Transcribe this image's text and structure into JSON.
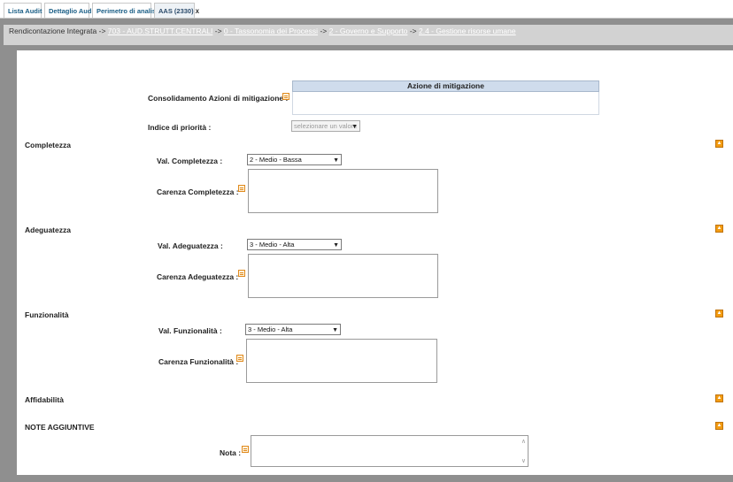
{
  "tabs": [
    {
      "label": "Lista Audit"
    },
    {
      "label": "Dettaglio Audit"
    },
    {
      "label": "Perimetro di analisi"
    },
    {
      "label": "AAS (2330)",
      "close": "x"
    }
  ],
  "breadcrumb": {
    "root": "Rendicontazione Integrata",
    "sep": "->",
    "items": [
      "703 - AUD.STRUTT.CENTRALI",
      "0 - Tassonomia dei Processi",
      "2 - Governo e Supporto",
      "2.4 - Gestione risorse umane"
    ]
  },
  "mitigation": {
    "label": "Consolidamento Azioni di mitigazione :",
    "table_header": "Azione di mitigazione"
  },
  "priority": {
    "label": "Indice di priorità :",
    "value": "selezionare un valore"
  },
  "sections": {
    "completezza": {
      "title": "Completezza",
      "val_label": "Val. Completezza :",
      "val_value": "2 - Medio - Bassa",
      "carenza_label": "Carenza Completezza :"
    },
    "adeguatezza": {
      "title": "Adeguatezza",
      "val_label": "Val. Adeguatezza :",
      "val_value": "3 - Medio - Alta",
      "carenza_label": "Carenza Adeguatezza :"
    },
    "funzionalita": {
      "title": "Funzionalità",
      "val_label": "Val. Funzionalità :",
      "val_value": "3 - Medio - Alta",
      "carenza_label": "Carenza Funzionalità :"
    },
    "affidabilita": {
      "title": "Affidabilità"
    },
    "note": {
      "title": "NOTE AGGIUNTIVE",
      "nota_label": "Nota :"
    }
  },
  "icons": {
    "edit": "edit-icon",
    "collapse": "collapse-up-icon",
    "dropdown": "chevron-down-icon"
  },
  "colors": {
    "accent_orange": "#f39c12",
    "tab_text": "#1a5e86",
    "table_header_bg": "#cfdcec",
    "background_grey": "#8f8f8f"
  }
}
